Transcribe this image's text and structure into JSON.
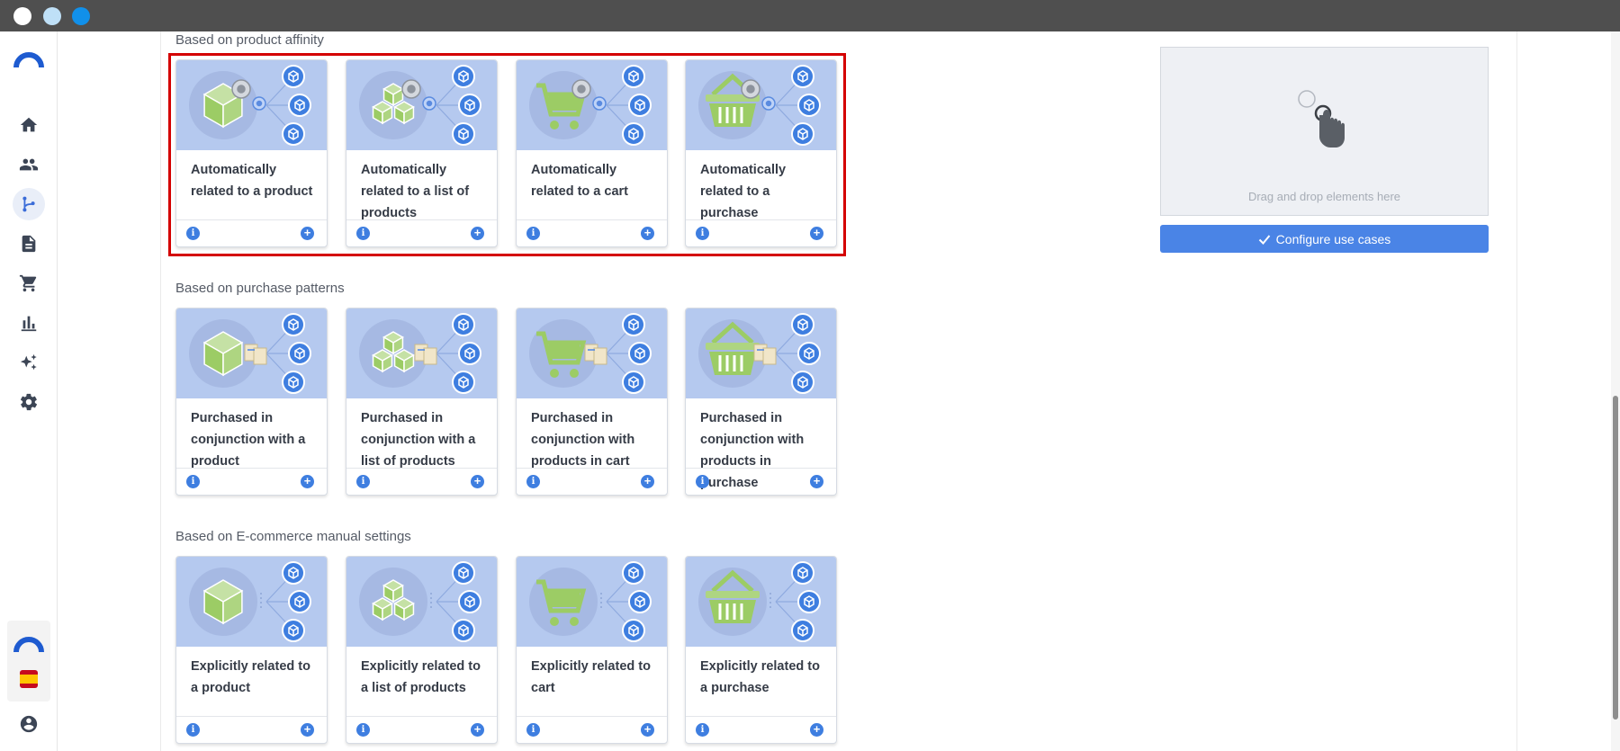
{
  "window": {
    "buttons": [
      "close",
      "minimize",
      "maximize"
    ]
  },
  "sidebar": {
    "items": [
      {
        "name": "home",
        "icon": "home-icon"
      },
      {
        "name": "contacts",
        "icon": "people-icon"
      },
      {
        "name": "flows",
        "icon": "branch-icon",
        "active": true
      },
      {
        "name": "documents",
        "icon": "document-icon"
      },
      {
        "name": "ecommerce",
        "icon": "cart-icon"
      },
      {
        "name": "analytics",
        "icon": "bar-chart-icon"
      },
      {
        "name": "ai",
        "icon": "sparkle-icon"
      },
      {
        "name": "settings",
        "icon": "gear-icon"
      }
    ],
    "language": "es",
    "profile_icon": "user-circle-icon"
  },
  "sections": [
    {
      "title": "Based on product affinity",
      "cards": [
        {
          "title": "Automatically related to a product",
          "image": "product-gear"
        },
        {
          "title": "Automatically related to a list of products",
          "image": "products-gear"
        },
        {
          "title": "Automatically related to a cart",
          "image": "cart-gear"
        },
        {
          "title": "Automatically related to a purchase",
          "image": "basket-gear"
        }
      ]
    },
    {
      "title": "Based on purchase patterns",
      "cards": [
        {
          "title": "Purchased in conjunction with a product",
          "image": "product-receipt"
        },
        {
          "title": "Purchased in conjunction with a list of products",
          "image": "products-receipt"
        },
        {
          "title": "Purchased in conjunction with products in cart",
          "image": "cart-receipt"
        },
        {
          "title": "Purchased in conjunction with products in purchase",
          "image": "basket-receipt"
        }
      ]
    },
    {
      "title": "Based on E-commerce manual settings",
      "cards": [
        {
          "title": "Explicitly related to a product",
          "image": "product-plain"
        },
        {
          "title": "Explicitly related to a list of products",
          "image": "products-plain"
        },
        {
          "title": "Explicitly related to cart",
          "image": "cart-plain"
        },
        {
          "title": "Explicitly related to a purchase",
          "image": "basket-plain"
        }
      ]
    }
  ],
  "dropzone": {
    "text": "Drag and drop elements here",
    "icon": "hand-pointer-icon"
  },
  "configure_button": {
    "label": "Configure use cases",
    "icon": "check-icon"
  },
  "colors": {
    "accent": "#4a84e6",
    "card_bg": "#b5c9ef",
    "product_green": "#9ccc65",
    "highlight": "#d40000"
  }
}
